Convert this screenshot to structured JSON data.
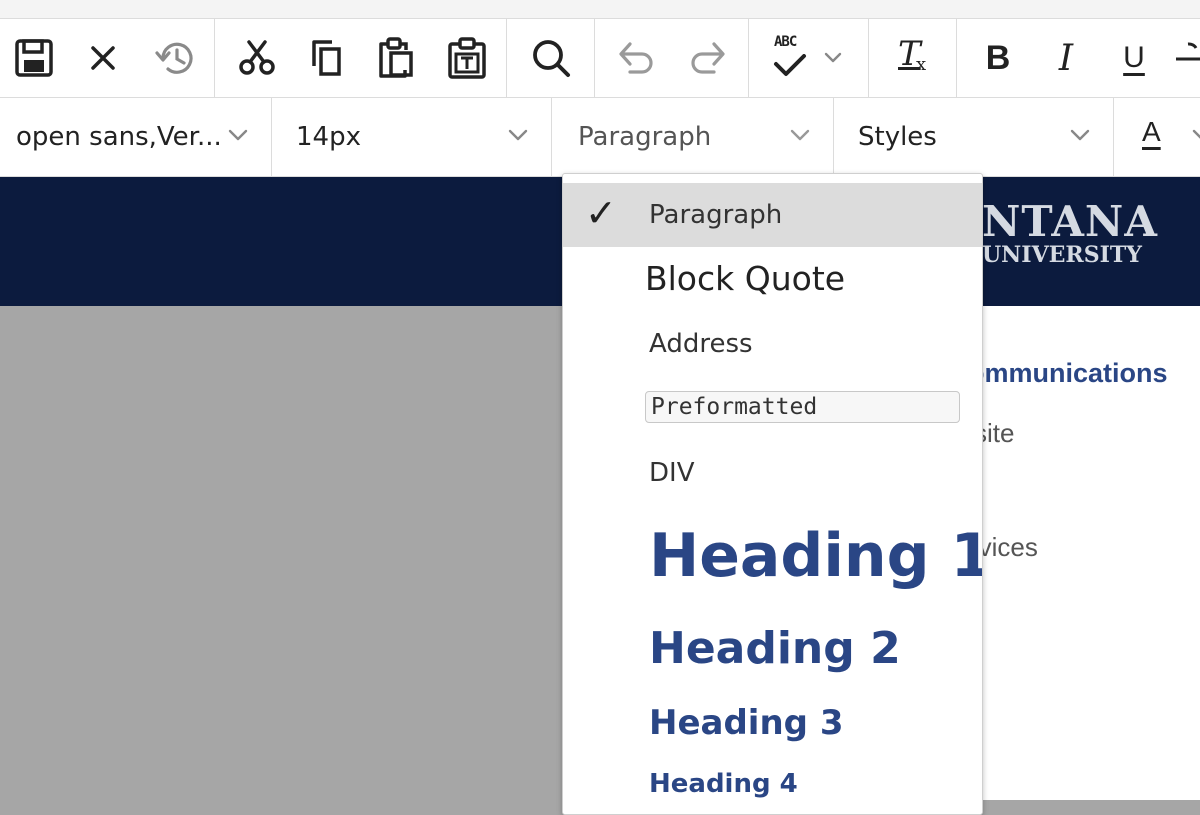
{
  "toolbar1": {
    "buttons": [
      {
        "name": "save"
      },
      {
        "name": "cancel"
      },
      {
        "name": "revisions"
      },
      {
        "name": "cut"
      },
      {
        "name": "copy"
      },
      {
        "name": "paste"
      },
      {
        "name": "paste-as-text"
      },
      {
        "name": "find"
      },
      {
        "name": "undo"
      },
      {
        "name": "redo"
      },
      {
        "name": "spellcheck"
      },
      {
        "name": "clear-formatting"
      },
      {
        "name": "bold"
      },
      {
        "name": "italic"
      },
      {
        "name": "underline"
      },
      {
        "name": "strikethrough"
      }
    ],
    "spellcheck_text": "ABC",
    "bold_glyph": "B",
    "italic_glyph": "I",
    "underline_glyph": "U",
    "clear_glyph": "T",
    "clear_sub": "x"
  },
  "toolbar2": {
    "font_family": "open sans,Ver...",
    "font_size": "14px",
    "block_format": "Paragraph",
    "styles": "Styles",
    "text_color_glyph": "A"
  },
  "highlight_color": "#ffff66",
  "banner": {
    "logo_line1": "NTANA",
    "logo_line2": "UNIVERSITY",
    "color": "#0c1b3e"
  },
  "content": {
    "line1": "ommunications",
    "line2": "site",
    "line3": "rvices"
  },
  "menu": {
    "items": [
      {
        "label": "Paragraph",
        "selected": true,
        "check": "✓"
      },
      {
        "label": "Block Quote"
      },
      {
        "label": "Address"
      },
      {
        "label": "Preformatted"
      },
      {
        "label": "DIV"
      },
      {
        "label": "Heading 1"
      },
      {
        "label": "Heading 2"
      },
      {
        "label": "Heading 3"
      },
      {
        "label": "Heading 4"
      }
    ],
    "heading_color": "#2a4685"
  }
}
